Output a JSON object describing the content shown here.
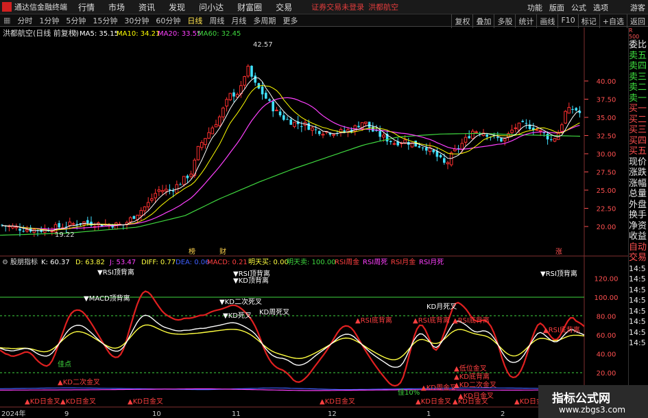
{
  "titlebar": {
    "app_name": "通达信金融终端",
    "menus": [
      "行情",
      "市场",
      "资讯",
      "发现",
      "问小达",
      "财富圈",
      "交易"
    ],
    "warning": "证券交易未登录",
    "stock": "洪都航空",
    "right_menus": [
      "功能",
      "版面",
      "公式",
      "选项"
    ],
    "user": "游客"
  },
  "toolbar": {
    "periods": [
      "分时",
      "1分钟",
      "5分钟",
      "15分钟",
      "30分钟",
      "60分钟",
      "日线",
      "周线",
      "月线",
      "多周期",
      "更多"
    ],
    "active_period": "日线",
    "right_buttons": [
      "复权",
      "叠加",
      "多股",
      "统计",
      "画线",
      "F10",
      "标记",
      "+自选",
      "返回"
    ]
  },
  "main": {
    "stock_label": "洪都航空(日线 前复权)",
    "ma5": "MA5: 35.15",
    "ma10": "MA10: 34.21",
    "ma20": "MA20: 33.55",
    "ma60": "MA60: 32.45",
    "high_label": "42.57",
    "low_label": "19.22",
    "price_ticks": [
      "40.00",
      "37.50",
      "35.00",
      "32.50",
      "30.00",
      "27.50",
      "25.00",
      "22.50",
      "20.00"
    ],
    "markers": [
      "榜",
      "财",
      "涨"
    ],
    "colors": {
      "ma5": "#ffffff",
      "ma10": "#ffff00",
      "ma20": "#ff40ff",
      "ma60": "#3fd83f",
      "up": "#ff3030",
      "down": "#40e0ff"
    }
  },
  "indicator": {
    "name": "股朋指标",
    "k": "K: 60.37",
    "d": "D: 63.82",
    "j": "J: 53.47",
    "diff": "DIFF: 0.77",
    "dea": "DEA: 0.06",
    "macd": "MACD: 0.21",
    "mtm": "明天买: 0.00",
    "mts": "明天卖: 100.00",
    "rsi_labels": [
      "RSI周金",
      "RSI周死",
      "RSI月金",
      "RSI月死"
    ],
    "ticks": [
      "120.00",
      "100.00",
      "80.00",
      "60.00",
      "40.00",
      "20.00"
    ],
    "annotations": {
      "a1": "▼RSI顶背离",
      "a2": "▼RSI顶背离",
      "a3": "▼KD顶背离",
      "a4": "▼RSI顶背离",
      "a5": "▼MACD顶背离",
      "a6": "▼KD二次死叉",
      "a7": "KD周死叉",
      "a8": "KD月死叉",
      "a9": "▼KD死叉",
      "a10": "▲RSI底背离",
      "a11": "▲RSI底背离",
      "a12": "▲RSI底背离",
      "a13": "▲RSI底背离",
      "a14": "佳点",
      "a15": "▲KD二次金叉",
      "a16": "▲低位金叉",
      "a17": "▲KD底背离",
      "a18": "▲KD二次金叉",
      "a19": "▲KD日金叉",
      "a20": "▲KD日金叉",
      "a21": "▲KD日金叉",
      "a22": "▲KD日金叉",
      "a23": "▲KD日金叉",
      "a24": "▲KD日金叉",
      "a25": "▲KD日金叉",
      "a26": "▲KD周金叉",
      "a27": "▲KD日金叉",
      "a28": "佳10%"
    }
  },
  "date_axis": [
    "2024年",
    "9",
    "10",
    "11",
    "12",
    "1",
    "2"
  ],
  "right_panel": {
    "top": "R",
    "top2": "500",
    "items": [
      "委比",
      "卖五",
      "卖四",
      "卖三",
      "卖二",
      "卖一",
      "买一",
      "买二",
      "买三",
      "买四",
      "买五",
      "现价",
      "涨跌",
      "涨幅",
      "总量",
      "外盘",
      "换手",
      "净资",
      "收益",
      "自动",
      "交易"
    ],
    "times": [
      "14:5",
      "14:5",
      "14:5",
      "14:5",
      "14:5",
      "14:5",
      "14:5",
      "14:5",
      "14:5"
    ]
  },
  "watermark": {
    "title": "指标公式网",
    "url": "www.zbgs3.com"
  }
}
